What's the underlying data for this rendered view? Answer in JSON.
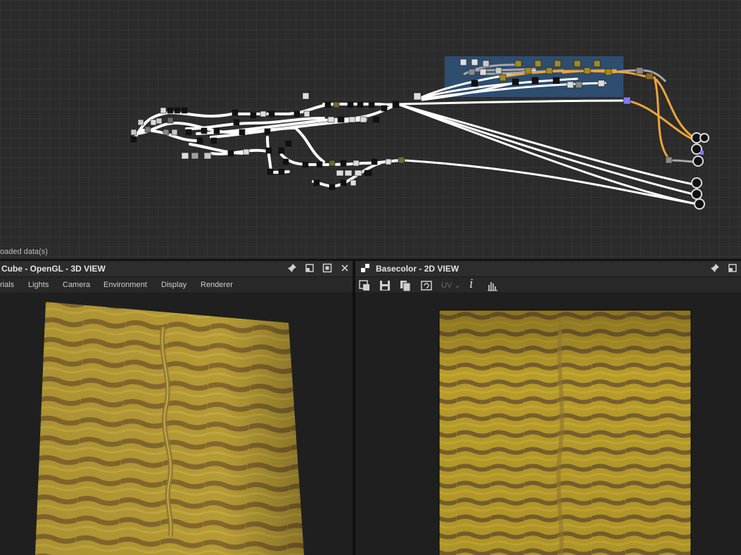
{
  "graph": {
    "status_text": "oaded data(s)"
  },
  "view3d": {
    "title": "Cube - OpenGL - 3D VIEW",
    "menu": [
      "rials",
      "Lights",
      "Camera",
      "Environment",
      "Display",
      "Renderer"
    ]
  },
  "view2d": {
    "title": "Basecolor - 2D VIEW",
    "uv_label": "UV"
  },
  "icons": {
    "pin": "pin-icon",
    "float": "float-icon",
    "maximize": "maximize-icon",
    "close": "close-icon",
    "checker": "checker-icon",
    "export": "export-icon",
    "save": "save-icon",
    "copy": "copy-icon",
    "refresh": "refresh-icon",
    "info": "info-icon",
    "histogram": "histogram-icon"
  },
  "colors": {
    "frame_highlight": "#2e4f73",
    "link_white": "#ffffff",
    "link_orange": "#f0a43a",
    "link_gray": "#a8a8a8",
    "texture_base": "#b89a2a",
    "texture_stripe": "#7a5a2a"
  }
}
